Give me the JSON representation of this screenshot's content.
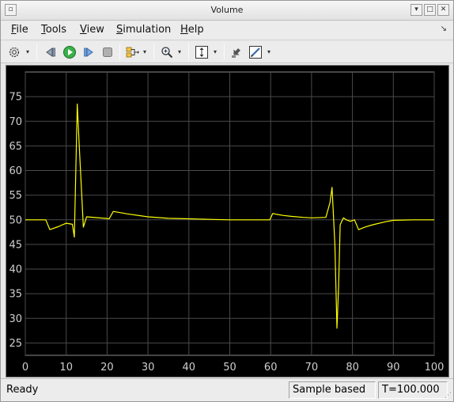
{
  "window": {
    "title": "Volume"
  },
  "menu": {
    "items": [
      {
        "mnemonic": "F",
        "rest": "ile"
      },
      {
        "mnemonic": "T",
        "rest": "ools"
      },
      {
        "mnemonic": "V",
        "rest": "iew"
      },
      {
        "mnemonic": "S",
        "rest": "imulation"
      },
      {
        "mnemonic": "H",
        "rest": "elp"
      }
    ]
  },
  "toolbar": {
    "icons": [
      "settings-icon",
      "step-back-icon",
      "run-icon",
      "step-forward-icon",
      "stop-icon",
      "signal-selector-icon",
      "zoom-icon",
      "autoscale-icon",
      "highlight-block-icon",
      "style-icon"
    ]
  },
  "status": {
    "ready": "Ready",
    "mode": "Sample based",
    "time": "T=100.000"
  },
  "colors": {
    "trace": "#ffff00",
    "background": "#000000",
    "grid": "#4a4a4a",
    "tick_text": "#cfcfcf"
  },
  "chart_data": {
    "type": "line",
    "title": "",
    "xlabel": "",
    "ylabel": "",
    "xlim": [
      0,
      100
    ],
    "ylim": [
      22.5,
      80
    ],
    "xticks": [
      0,
      10,
      20,
      30,
      40,
      50,
      60,
      70,
      80,
      90,
      100
    ],
    "yticks": [
      25,
      30,
      35,
      40,
      45,
      50,
      55,
      60,
      65,
      70,
      75
    ],
    "grid": true,
    "series": [
      {
        "color": "#ffff00",
        "x": [
          0,
          5,
          6,
          8,
          10,
          11.5,
          12,
          12.7,
          13.2,
          14.2,
          15,
          19.5,
          20.5,
          21.5,
          25,
          30,
          35,
          40,
          45,
          50,
          55,
          59.8,
          60.5,
          61.5,
          63,
          65,
          68,
          70,
          73.5,
          74.5,
          75,
          75.7,
          76.2,
          76.6,
          77,
          77.8,
          78.5,
          79.5,
          80.5,
          81.5,
          83,
          85,
          88,
          90,
          95,
          100
        ],
        "y": [
          50,
          50,
          48,
          48.6,
          49.3,
          49.1,
          46.5,
          73.5,
          65,
          48.5,
          50.6,
          50.3,
          50.2,
          51.7,
          51.2,
          50.6,
          50.3,
          50.2,
          50.1,
          50,
          50,
          50,
          51.3,
          51.1,
          50.9,
          50.7,
          50.5,
          50.4,
          50.5,
          53.5,
          56.6,
          45,
          28,
          36,
          49,
          50.4,
          50,
          49.7,
          50,
          48,
          48.5,
          49,
          49.6,
          49.9,
          50,
          50
        ]
      }
    ]
  }
}
